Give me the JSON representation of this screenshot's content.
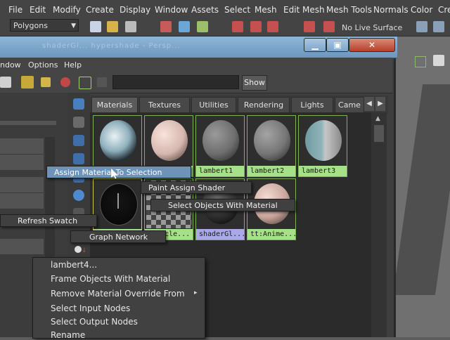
{
  "main_menu": [
    "File",
    "Edit",
    "Modify",
    "Create",
    "Display",
    "Window",
    "Assets",
    "Select",
    "Mesh",
    "Edit Mesh",
    "Mesh Tools",
    "Normals",
    "Color",
    "Crea"
  ],
  "status_line": {
    "mode": "Polygons",
    "live_surface": "No Live Surface"
  },
  "window": {
    "title_faded": "shaderGl... hypershade - Persp..."
  },
  "window_menu": [
    "ndow",
    "Options",
    "Help"
  ],
  "toolbar": {
    "show_button": "Show"
  },
  "tabs": [
    "Materials",
    "Textures",
    "Utilities",
    "Rendering",
    "Lights",
    "Came"
  ],
  "swatches_row1": [
    "",
    "",
    "lambert1",
    "lambert2",
    "lambert3"
  ],
  "swatches_row2": [
    "",
    "...icle...",
    "shaderGl...",
    "tt:Anime..."
  ],
  "popups": {
    "assign": "Assign Material To Selection",
    "paint": "Paint Assign Shader",
    "select_objects": "Select Objects With Material",
    "refresh": "Refresh Swatch",
    "graph": "Graph Network"
  },
  "context_menu": {
    "items": [
      "lambert4...",
      "Frame Objects With Material",
      "Remove Material Override From",
      "Select Input Nodes",
      "Select Output Nodes",
      "Rename"
    ],
    "submenu_arrow": "▸"
  },
  "colors": {
    "accent": "#6e93b9",
    "swatch_label": "#a6e089",
    "swatch_label_shader": "#a9a9e8"
  }
}
